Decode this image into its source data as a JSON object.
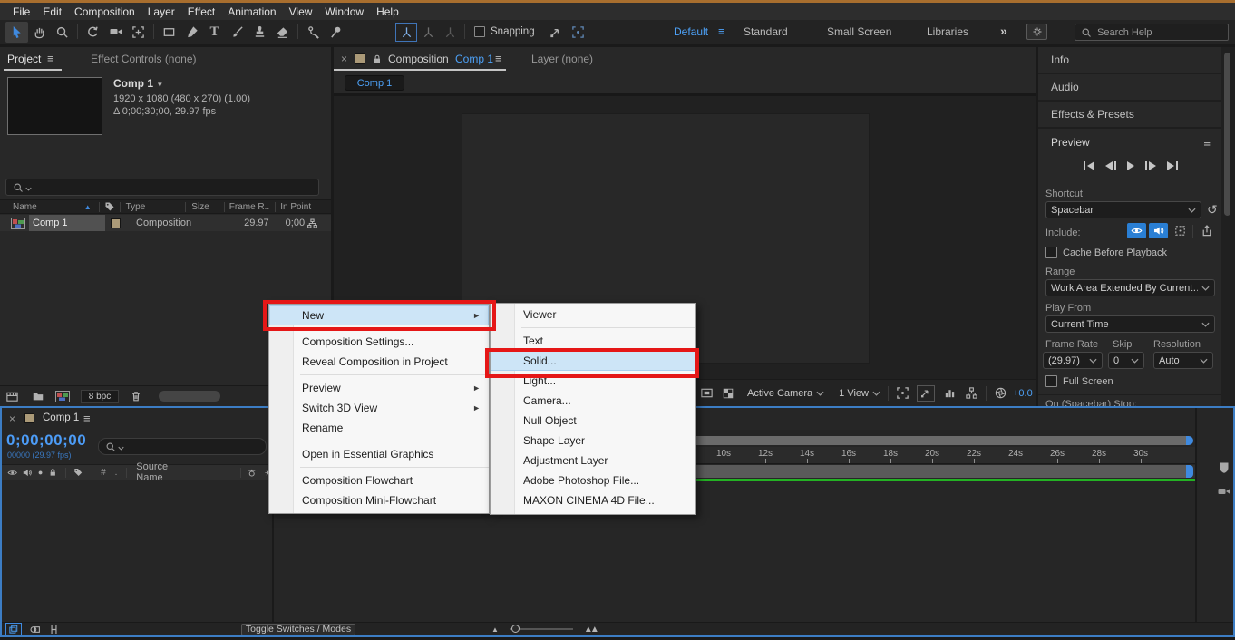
{
  "colors": {
    "accent_blue": "#3f8ae0",
    "text_blue": "#4c9cf7",
    "annotation_red": "#e51717",
    "cache_green": "#23b123",
    "menu_highlight": "#cde5f7",
    "tan_chip": "#ab9a78"
  },
  "icons": {
    "hamburger": "≡",
    "close": "×",
    "dropdown_caret": "▼",
    "submenu_arrow": "►",
    "overflow": "»",
    "reset": "↺",
    "sort_asc": "▲",
    "solo_dot": "●",
    "small_tri": "▲",
    "big_tri": "▲▲"
  },
  "menubar": {
    "items": [
      "File",
      "Edit",
      "Composition",
      "Layer",
      "Effect",
      "Animation",
      "View",
      "Window",
      "Help"
    ]
  },
  "toolbar": {
    "snapping_label": "Snapping",
    "workspaces": [
      "Default",
      "Standard",
      "Small Screen",
      "Libraries"
    ],
    "search_placeholder": "Search Help"
  },
  "project": {
    "tab_project": "Project",
    "tab_effect_controls": "Effect Controls (none)",
    "comp_name": "Comp 1",
    "info_line1": "1920 x 1080  (480 x 270) (1.00)",
    "info_line2": "Δ 0;00;30;00, 29.97 fps",
    "columns": {
      "name": "Name",
      "type": "Type",
      "size": "Size",
      "frame_rate": "Frame R..",
      "in_point": "In Point"
    },
    "row": {
      "name": "Comp 1",
      "type": "Composition",
      "frame_rate": "29.97",
      "in_point": "0;00"
    },
    "footer": {
      "bpc": "8 bpc"
    }
  },
  "viewer": {
    "tab_prefix": "Composition",
    "tab_comp": "Comp 1",
    "layer_tab": "Layer  (none)",
    "breadcrumb": "Comp 1",
    "camera_select": "Active Camera",
    "view_layout": "1 View",
    "exposure": "+0.0"
  },
  "sidebar": {
    "sections": {
      "info": "Info",
      "audio": "Audio",
      "effects": "Effects & Presets",
      "preview": "Preview"
    },
    "shortcut_label": "Shortcut",
    "shortcut_value": "Spacebar",
    "include_label": "Include:",
    "cache_label": "Cache Before Playback",
    "range_label": "Range",
    "range_value": "Work Area Extended By Current…",
    "play_from_label": "Play From",
    "play_from_value": "Current Time",
    "frame_rate_label": "Frame Rate",
    "frame_rate_value": "(29.97)",
    "skip_label": "Skip",
    "skip_value": "0",
    "resolution_label": "Resolution",
    "resolution_value": "Auto",
    "full_screen_label": "Full Screen",
    "stop_label": "On (Spacebar) Stop:"
  },
  "timeline": {
    "tab": "Comp 1",
    "timecode": "0;00;00;00",
    "frames_info": "00000 (29.97 fps)",
    "hash": "#",
    "dot": ".",
    "source_name": "Source Name",
    "ruler_ticks": [
      "10s",
      "12s",
      "14s",
      "16s",
      "18s",
      "20s",
      "22s",
      "24s",
      "26s",
      "28s",
      "30s"
    ],
    "toggle_button": "Toggle Switches / Modes"
  },
  "context_menu": {
    "items": [
      {
        "label": "New"
      },
      {
        "label": "Composition Settings..."
      },
      {
        "label": "Reveal Composition in Project"
      },
      {
        "label": "Preview"
      },
      {
        "label": "Switch 3D View"
      },
      {
        "label": "Rename"
      },
      {
        "label": "Open in Essential Graphics"
      },
      {
        "label": "Composition Flowchart"
      },
      {
        "label": "Composition Mini-Flowchart"
      }
    ]
  },
  "submenu": {
    "items": [
      {
        "label": "Viewer"
      },
      {
        "label": "Text"
      },
      {
        "label": "Solid..."
      },
      {
        "label": "Light..."
      },
      {
        "label": "Camera..."
      },
      {
        "label": "Null Object"
      },
      {
        "label": "Shape Layer"
      },
      {
        "label": "Adjustment Layer"
      },
      {
        "label": "Adobe Photoshop File..."
      },
      {
        "label": "MAXON CINEMA 4D File..."
      }
    ]
  }
}
